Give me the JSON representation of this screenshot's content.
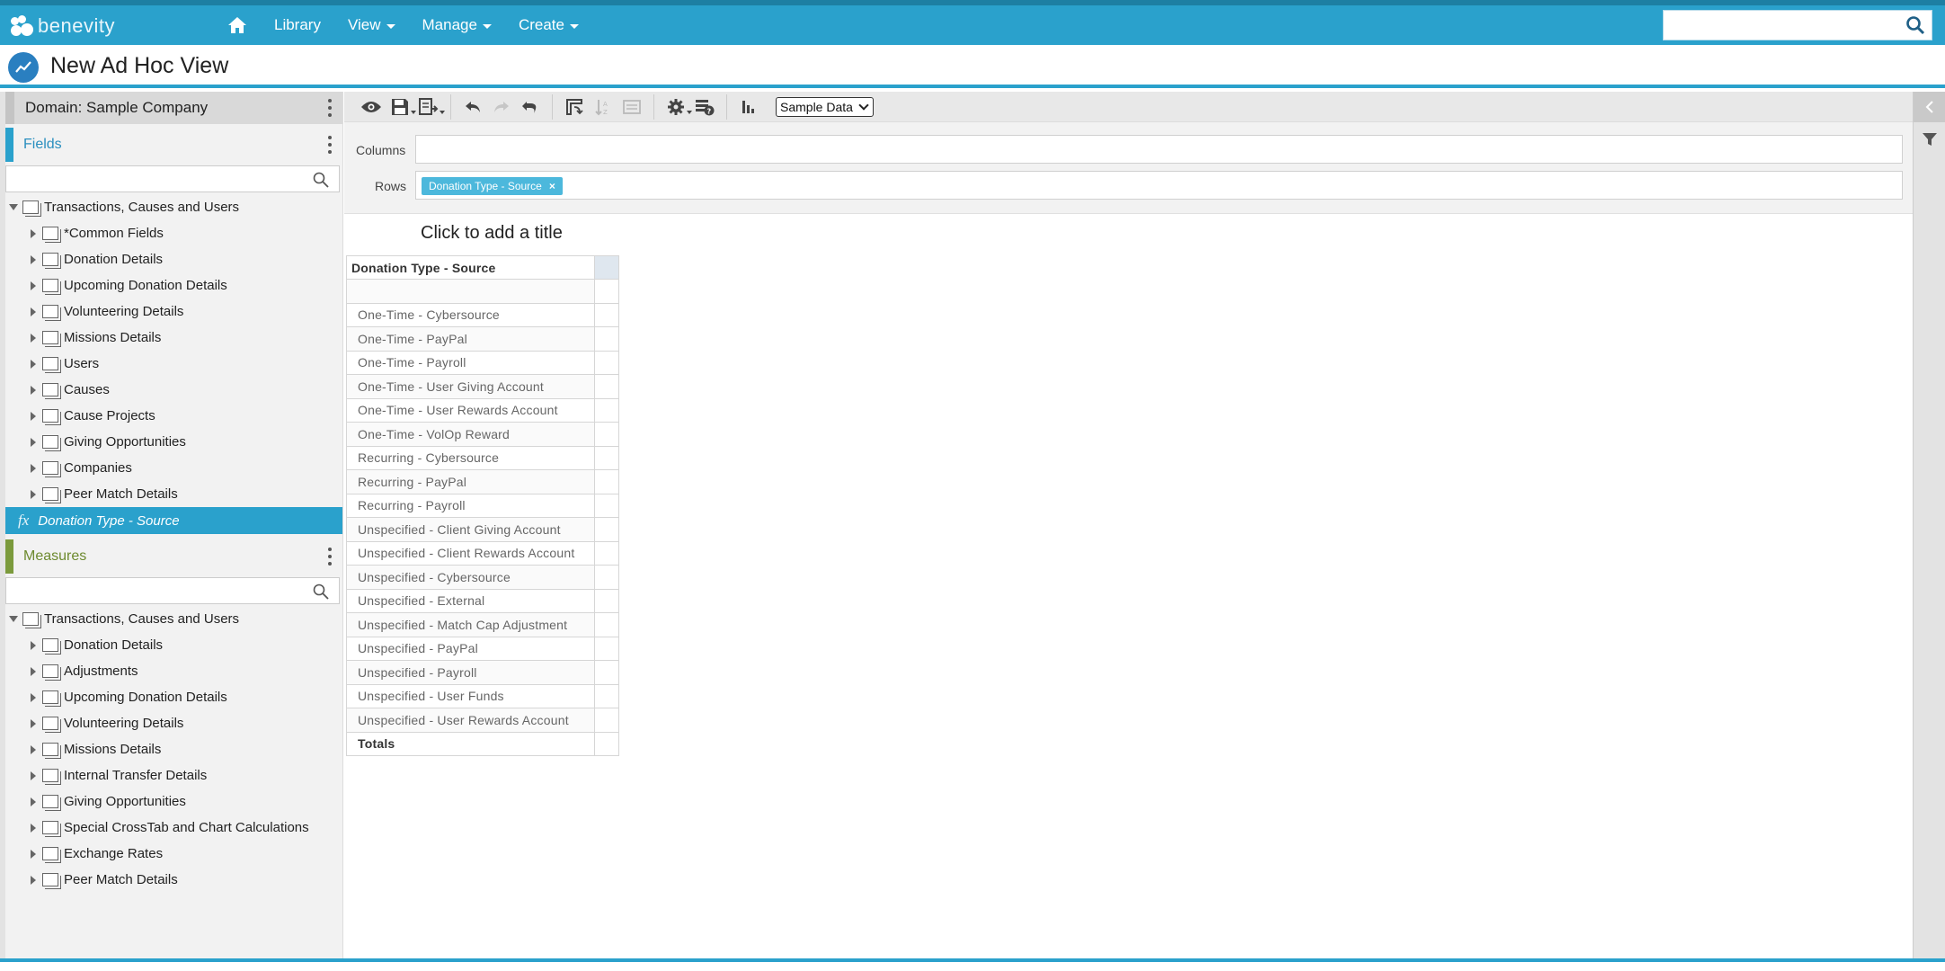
{
  "app": {
    "logo_text": "benevity"
  },
  "nav": {
    "library": "Library",
    "view": "View",
    "manage": "Manage",
    "create": "Create"
  },
  "search": {
    "value": ""
  },
  "page": {
    "title": "New Ad Hoc View"
  },
  "left": {
    "domain_label": "Domain: Sample Company",
    "fields_label": "Fields",
    "fields_filter": "",
    "fields_tree_root": "Transactions, Causes and Users",
    "fields_items": [
      "*Common Fields",
      "Donation Details",
      "Upcoming Donation Details",
      "Volunteering Details",
      "Missions Details",
      "Users",
      "Causes",
      "Cause Projects",
      "Giving Opportunities",
      "Companies",
      "Peer Match Details"
    ],
    "selected_field": "Donation Type - Source",
    "selected_prefix": "fx",
    "measures_label": "Measures",
    "measures_filter": "",
    "measures_tree_root": "Transactions, Causes and Users",
    "measures_items": [
      "Donation Details",
      "Adjustments",
      "Upcoming Donation Details",
      "Volunteering Details",
      "Missions Details",
      "Internal Transfer Details",
      "Giving Opportunities",
      "Special CrossTab and Chart Calculations",
      "Exchange Rates",
      "Peer Match Details"
    ]
  },
  "toolbar": {
    "data_select": "Sample Data"
  },
  "shelf": {
    "columns_label": "Columns",
    "rows_label": "Rows",
    "rows_pill": "Donation Type - Source",
    "pill_remove": "×"
  },
  "canvas": {
    "title_prompt": "Click to add a title",
    "table_header": "Donation Type - Source",
    "rows": [
      "One-Time - Cybersource",
      "One-Time - PayPal",
      "One-Time - Payroll",
      "One-Time - User Giving Account",
      "One-Time - User Rewards Account",
      "One-Time - VolOp Reward",
      "Recurring - Cybersource",
      "Recurring - PayPal",
      "Recurring - Payroll",
      "Unspecified - Client Giving Account",
      "Unspecified - Client Rewards Account",
      "Unspecified - Cybersource",
      "Unspecified - External",
      "Unspecified - Match Cap Adjustment",
      "Unspecified - PayPal",
      "Unspecified - Payroll",
      "Unspecified - User Funds",
      "Unspecified - User Rewards Account"
    ],
    "totals_label": "Totals"
  },
  "colors": {
    "accent": "#2aa1cc",
    "fields_accent": "#2aa1cc",
    "measures_accent": "#7b9a3c",
    "header_cell": "#dfe7ef"
  }
}
